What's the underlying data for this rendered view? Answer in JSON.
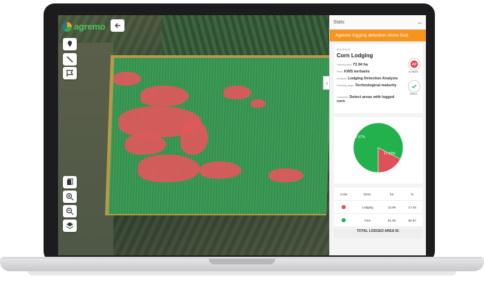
{
  "app": {
    "logo_text": "agremo"
  },
  "panel": {
    "header_title": "Stats",
    "banner": "Agremo logging detection demo field",
    "card": {
      "date": "05/10/2022",
      "title": "Corn Lodging",
      "fields": [
        {
          "key": "Harvest field:",
          "value": "73.94 ha"
        },
        {
          "key": "Plant:",
          "value": "KWS kerbanis"
        },
        {
          "key": "Analysis:",
          "value": "Lodging Detection Analysis"
        },
        {
          "key": "Growing stage:",
          "value": "Technological maturity"
        },
        {
          "key": "Comment:",
          "value": "Detect areas with logged corn"
        }
      ],
      "analysis_label": "Analysis",
      "status_label": "Status"
    },
    "pie": {
      "labels": [
        "82.57%",
        "17.43%"
      ],
      "colors": {
        "fine": "#22b14c",
        "lodging": "#e0505a"
      }
    },
    "table": {
      "headers": [
        "Color",
        "Desc.",
        "ha",
        "%"
      ],
      "rows": [
        {
          "desc": "Lodging",
          "ha": "12.89",
          "pct": "17.43",
          "color": "#e0505a"
        },
        {
          "desc": "Fine",
          "ha": "61.05",
          "pct": "82.57",
          "color": "#22b14c"
        }
      ]
    },
    "total_label": "TOTAL LODGED AREA IS:"
  },
  "chart_data": {
    "type": "pie",
    "categories": [
      "Fine",
      "Lodging"
    ],
    "values": [
      82.57,
      17.43
    ]
  }
}
